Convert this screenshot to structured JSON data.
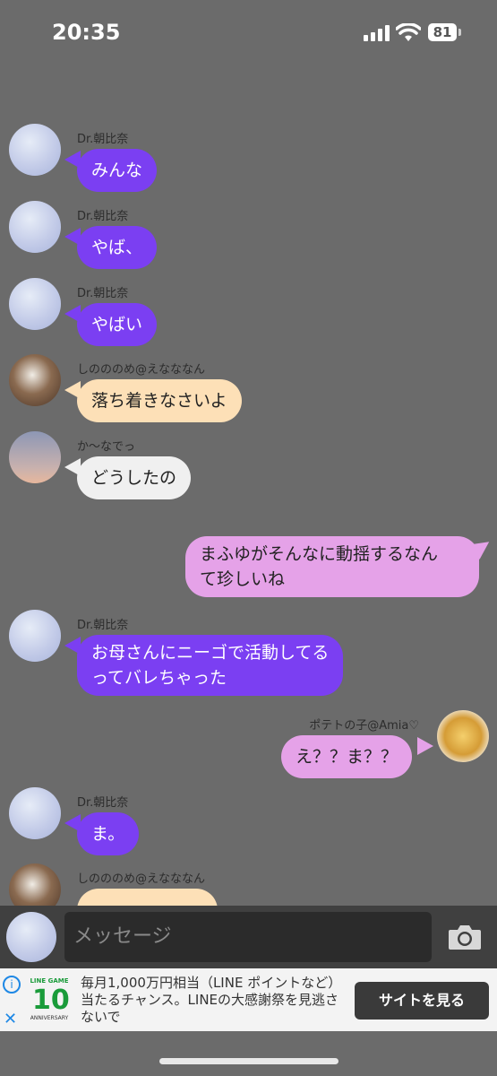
{
  "status_bar": {
    "time": "20:35",
    "battery": "81"
  },
  "messages": [
    {
      "side": "left",
      "sender": "Dr.朝比奈",
      "text": "みんな",
      "color": "purple"
    },
    {
      "side": "left",
      "sender": "Dr.朝比奈",
      "text": "やば、",
      "color": "purple"
    },
    {
      "side": "left",
      "sender": "Dr.朝比奈",
      "text": "やばい",
      "color": "purple"
    },
    {
      "side": "left",
      "sender": "しのののめ@えなななん",
      "text": "落ち着きなさいよ",
      "color": "cream"
    },
    {
      "side": "left",
      "sender": "か〜なでっ",
      "text": "どうしたの",
      "color": "grey"
    },
    {
      "side": "right",
      "sender": "",
      "line1": "まふゆがそんなに動揺するなん",
      "line2": "て珍しいね",
      "color": "pink"
    },
    {
      "side": "left",
      "sender": "Dr.朝比奈",
      "line1": "お母さんにニーゴで活動してる",
      "line2": "ってバレちゃった",
      "color": "purple"
    },
    {
      "side": "right",
      "sender": "ポテトの子@Amia♡",
      "text": "え？？ま？？",
      "color": "pink"
    },
    {
      "side": "left",
      "sender": "Dr.朝比奈",
      "text": "ま。",
      "color": "purple"
    },
    {
      "side": "left",
      "sender": "しのののめ@えなななん",
      "text": "",
      "color": "cream"
    }
  ],
  "input": {
    "placeholder": "メッセージ"
  },
  "ad": {
    "logo_top": "LINE GAME",
    "logo_number": "10",
    "logo_bottom": "ANNIVERSARY",
    "text": "毎月1,000万円相当（LINE ポイントなど）当たるチャンス。LINEの大感謝祭を見逃さないで",
    "cta": "サイトを見る"
  },
  "colors": {
    "background": "#6b6b6b",
    "purple_bubble": "#7b3ff2",
    "cream_bubble": "#fde0b7",
    "grey_bubble": "#f0f0f0",
    "pink_bubble": "#e5a2e8"
  }
}
